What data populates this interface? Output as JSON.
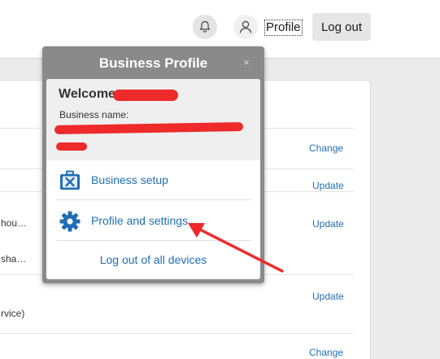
{
  "header": {
    "profile_label": "Profile",
    "logout_label": "Log out"
  },
  "content": {
    "actions": [
      "Change",
      "Update",
      "Update",
      "Update",
      "Change"
    ],
    "fragments": [
      "hou…",
      "sha…",
      "rvice)"
    ]
  },
  "popup": {
    "title": "Business Profile",
    "close_glyph": "×",
    "welcome": "Welcome",
    "business_name_label": "Business name:",
    "business_name_value": "",
    "menu": [
      {
        "label": "Business setup",
        "icon": "toolbox-icon"
      },
      {
        "label": "Profile and settings",
        "icon": "gear-icon"
      }
    ],
    "logout_all_label": "Log out of all devices"
  },
  "colors": {
    "link": "#1f6fb5",
    "popup_frame": "#8a8a8a",
    "annotation": "#ee2a2a"
  }
}
